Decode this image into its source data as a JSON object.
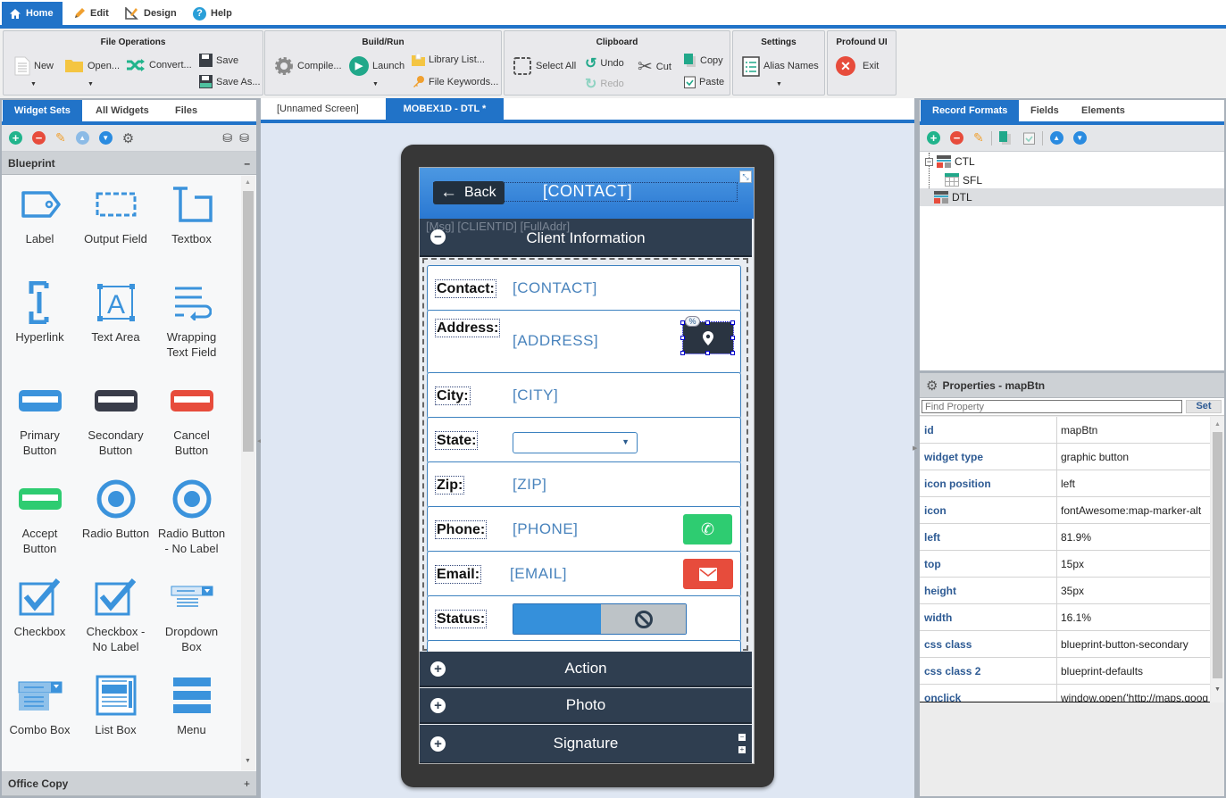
{
  "menu_tabs": [
    {
      "label": "Home",
      "icon": "home-icon",
      "active": true
    },
    {
      "label": "Edit",
      "icon": "pencil-icon"
    },
    {
      "label": "Design",
      "icon": "design-ruler-icon"
    },
    {
      "label": "Help",
      "icon": "help-icon"
    }
  ],
  "ribbon": {
    "file_ops": {
      "title": "File Operations",
      "new": "New",
      "open": "Open...",
      "convert": "Convert...",
      "save": "Save",
      "save_as": "Save As..."
    },
    "build_run": {
      "title": "Build/Run",
      "compile": "Compile...",
      "launch": "Launch",
      "library_list": "Library List...",
      "file_keywords": "File Keywords..."
    },
    "clipboard": {
      "title": "Clipboard",
      "select_all": "Select All",
      "undo": "Undo",
      "redo": "Redo",
      "cut": "Cut",
      "copy": "Copy",
      "paste": "Paste"
    },
    "settings": {
      "title": "Settings",
      "alias_names": "Alias Names"
    },
    "profound": {
      "title": "Profound UI",
      "exit": "Exit"
    }
  },
  "left_panel": {
    "tabs": [
      "Widget Sets",
      "All Widgets",
      "Files"
    ],
    "section": "Blueprint",
    "section_toggle": "–",
    "footer_section": "Office Copy",
    "footer_toggle": "+",
    "widgets": [
      {
        "label": "Label",
        "icon": "label-tag-icon"
      },
      {
        "label": "Output Field",
        "icon": "output-field-icon"
      },
      {
        "label": "Textbox",
        "icon": "textbox-icon"
      },
      {
        "label": "Hyperlink",
        "icon": "hyperlink-icon"
      },
      {
        "label": "Text Area",
        "icon": "text-area-icon"
      },
      {
        "label": "Wrapping Text Field",
        "icon": "wrapping-text-icon"
      },
      {
        "label": "Primary Button",
        "icon": "primary-button-icon"
      },
      {
        "label": "Secondary Button",
        "icon": "secondary-button-icon"
      },
      {
        "label": "Cancel Button",
        "icon": "cancel-button-icon"
      },
      {
        "label": "Accept Button",
        "icon": "accept-button-icon"
      },
      {
        "label": "Radio Button",
        "icon": "radio-button-icon"
      },
      {
        "label": "Radio Button - No Label",
        "icon": "radio-button-icon"
      },
      {
        "label": "Checkbox",
        "icon": "checkbox-icon"
      },
      {
        "label": "Checkbox - No Label",
        "icon": "checkbox-icon"
      },
      {
        "label": "Dropdown Box",
        "icon": "dropdown-icon"
      },
      {
        "label": "Combo Box",
        "icon": "combo-box-icon"
      },
      {
        "label": "List Box",
        "icon": "list-box-icon"
      },
      {
        "label": "Menu",
        "icon": "menu-icon"
      }
    ]
  },
  "designer": {
    "tabs": [
      {
        "label": "[Unnamed Screen]",
        "active": false
      },
      {
        "label": "MOBEX1D - DTL *",
        "active": true
      }
    ],
    "screen": {
      "back_label": "Back",
      "title": "[CONTACT]",
      "hidden_fields": "[Msg]  [CLIENTID] [FullAddr]",
      "section_title": "Client Information",
      "map_badge": "%",
      "fields": [
        {
          "label": "Contact:",
          "value": "[CONTACT]"
        },
        {
          "label": "Address:",
          "value": "[ADDRESS]"
        },
        {
          "label": "City:",
          "value": "[CITY]"
        },
        {
          "label": "State:",
          "value": ""
        },
        {
          "label": "Zip:",
          "value": "[ZIP]"
        },
        {
          "label": "Phone:",
          "value": "[PHONE]"
        },
        {
          "label": "Email:",
          "value": "[EMAIL]"
        },
        {
          "label": "Status:",
          "value": ""
        }
      ],
      "accordions": [
        "Action",
        "Photo",
        "Signature"
      ],
      "colors": {
        "phone_button": "#2ecc71",
        "email_button": "#e74c3c",
        "map_button": "#2a3441",
        "accent": "#2173c8"
      }
    }
  },
  "right_panel": {
    "tabs": [
      "Record Formats",
      "Fields",
      "Elements"
    ],
    "tree": [
      {
        "label": "CTL",
        "level": 0,
        "expanded": true
      },
      {
        "label": "SFL",
        "level": 1
      },
      {
        "label": "DTL",
        "level": 0,
        "selected": true
      }
    ],
    "properties": {
      "title": "Properties - mapBtn",
      "find_placeholder": "Find Property",
      "set_label": "Set",
      "rows": [
        {
          "key": "id",
          "value": "mapBtn"
        },
        {
          "key": "widget type",
          "value": "graphic button"
        },
        {
          "key": "icon position",
          "value": "left"
        },
        {
          "key": "icon",
          "value": "fontAwesome:map-marker-alt"
        },
        {
          "key": "left",
          "value": "81.9%"
        },
        {
          "key": "top",
          "value": "15px"
        },
        {
          "key": "height",
          "value": "35px"
        },
        {
          "key": "width",
          "value": "16.1%"
        },
        {
          "key": "css class",
          "value": "blueprint-button-secondary"
        },
        {
          "key": "css class 2",
          "value": "blueprint-defaults"
        },
        {
          "key": "onclick",
          "value": "window.open('http://maps.goog"
        }
      ]
    }
  }
}
